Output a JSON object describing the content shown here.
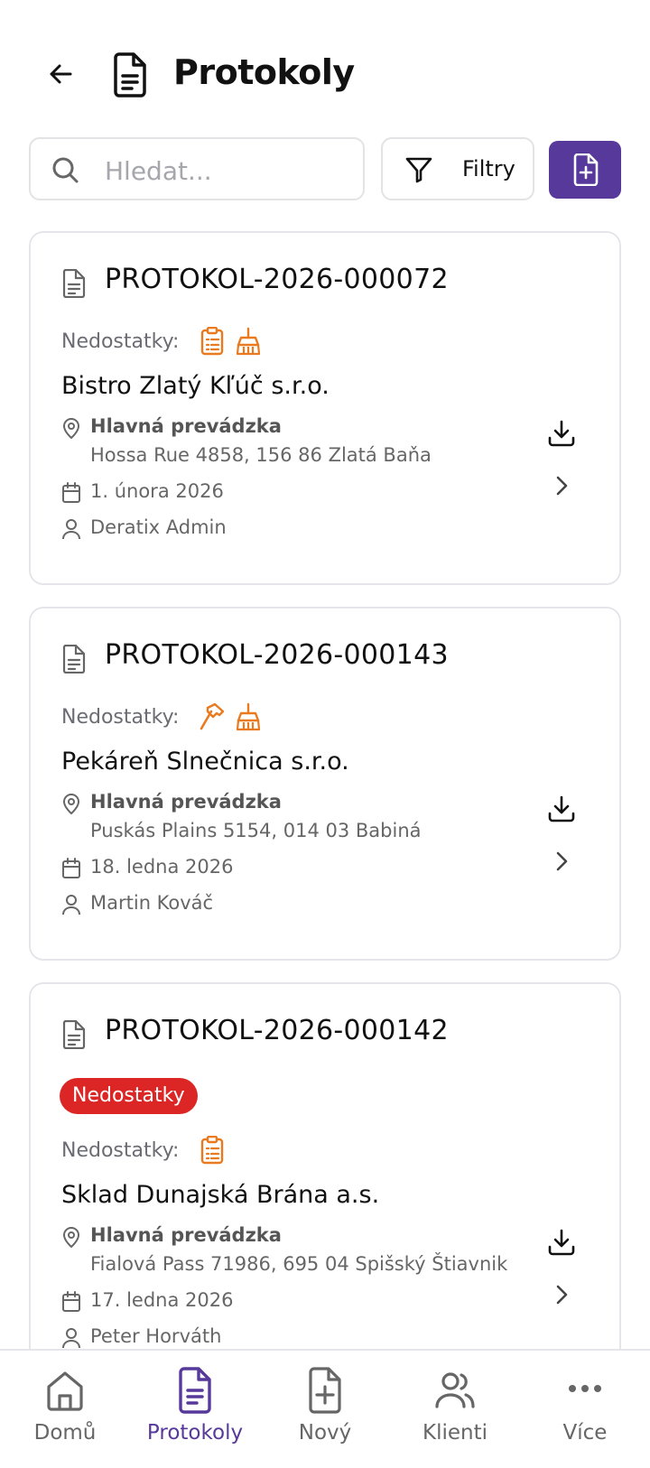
{
  "header": {
    "title": "Protokoly"
  },
  "toolbar": {
    "search_placeholder": "Hledat...",
    "filter_label": "Filtry"
  },
  "cards": [
    {
      "id": "PROTOKOL-2026-000072",
      "defects_label": "Nedostatky:",
      "defect_icons": [
        "clipboard-list-icon",
        "broom-icon"
      ],
      "client": "Bistro Zlatý Kľúč s.r.o.",
      "location_name": "Hlavná prevádzka",
      "address": "Hossa Rue 4858, 156 86 Zlatá Baňa",
      "date": "1. února 2026",
      "person": "Deratix Admin"
    },
    {
      "id": "PROTOKOL-2026-000143",
      "defects_label": "Nedostatky:",
      "defect_icons": [
        "hammer-icon",
        "broom-icon"
      ],
      "client": "Pekáreň Slnečnica s.r.o.",
      "location_name": "Hlavná prevádzka",
      "address": "Puskás Plains 5154, 014 03 Babiná",
      "date": "18. ledna 2026",
      "person": "Martin Kováč"
    },
    {
      "id": "PROTOKOL-2026-000142",
      "badge": "Nedostatky",
      "defects_label": "Nedostatky:",
      "defect_icons": [
        "clipboard-list-icon"
      ],
      "client": "Sklad Dunajská Brána a.s.",
      "location_name": "Hlavná prevádzka",
      "address": "Fialová Pass 71986, 695 04 Spišský Štiavnik",
      "date": "17. ledna 2026",
      "person": "Peter Horváth"
    }
  ],
  "nav": [
    {
      "label": "Domů",
      "icon": "home-icon"
    },
    {
      "label": "Protokoly",
      "icon": "document-icon",
      "active": true
    },
    {
      "label": "Nový",
      "icon": "file-plus-icon"
    },
    {
      "label": "Klienti",
      "icon": "users-icon"
    },
    {
      "label": "Více",
      "icon": "more-icon"
    }
  ],
  "colors": {
    "accent": "#56399a",
    "defect_icon": "#ea7a1f",
    "badge": "#dc2626"
  }
}
